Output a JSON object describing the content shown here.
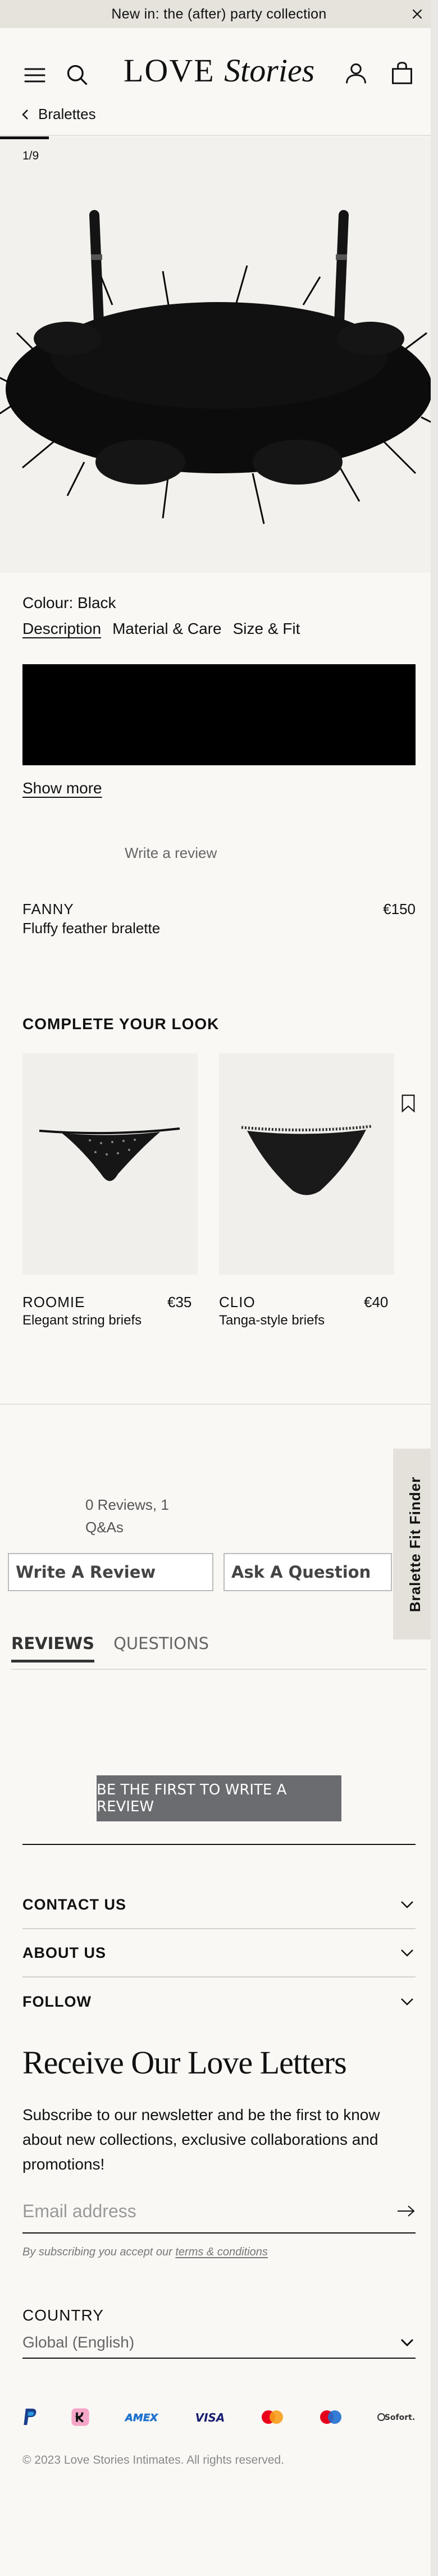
{
  "announcement": {
    "text": "New in: the (after) party collection"
  },
  "header": {
    "logo_main": "LOVE",
    "logo_script": "Stories"
  },
  "breadcrumb": {
    "label": "Bralettes"
  },
  "gallery": {
    "counter": "1/9",
    "progress": 0.111
  },
  "product": {
    "colour": "Colour: Black",
    "tabs": [
      "Description",
      "Material & Care",
      "Size & Fit"
    ],
    "show_more": "Show more",
    "write_review": "Write a review",
    "name": "FANNY",
    "subtitle": "Fluffy feather bralette",
    "price": "€150"
  },
  "complete_look": {
    "title": "COMPLETE YOUR LOOK",
    "items": [
      {
        "name": "ROOMIE",
        "price": "€35",
        "desc": "Elegant string briefs"
      },
      {
        "name": "CLIO",
        "price": "€40",
        "desc": "Tanga-style briefs"
      }
    ]
  },
  "fit_finder": {
    "label": "Bralette Fit Finder"
  },
  "reviews": {
    "summary_line1": "0 Reviews, 1",
    "summary_line2": "Q&As",
    "write_button": "Write A Review",
    "ask_button": "Ask A Question",
    "tabs": [
      "REVIEWS",
      "QUESTIONS"
    ],
    "first_button": "BE THE FIRST TO WRITE A REVIEW"
  },
  "footer": {
    "accordions": [
      "CONTACT US",
      "ABOUT US",
      "FOLLOW"
    ],
    "newsletter_title": "Receive Our Love Letters",
    "newsletter_text": "Subscribe to our newsletter and be the first to know about new collections, exclusive collaborations and promotions!",
    "email_placeholder": "Email address",
    "terms_prefix": "By subscribing you accept our ",
    "terms_link": "terms & conditions",
    "country_label": "COUNTRY",
    "country_value": "Global (English)",
    "payments": [
      "paypal-icon",
      "klarna-icon",
      "amex-icon",
      "visa-icon",
      "mastercard-icon",
      "maestro-icon",
      "sofort-icon"
    ],
    "payment_text": {
      "amex": "AMEX",
      "visa": "VISA",
      "sofort": "Sofort."
    },
    "copyright": "© 2023 Love Stories Intimates. All rights reserved."
  },
  "colors": {
    "accent": "#111111",
    "background": "#f9f8f5",
    "button_grey": "#6b6c70"
  }
}
